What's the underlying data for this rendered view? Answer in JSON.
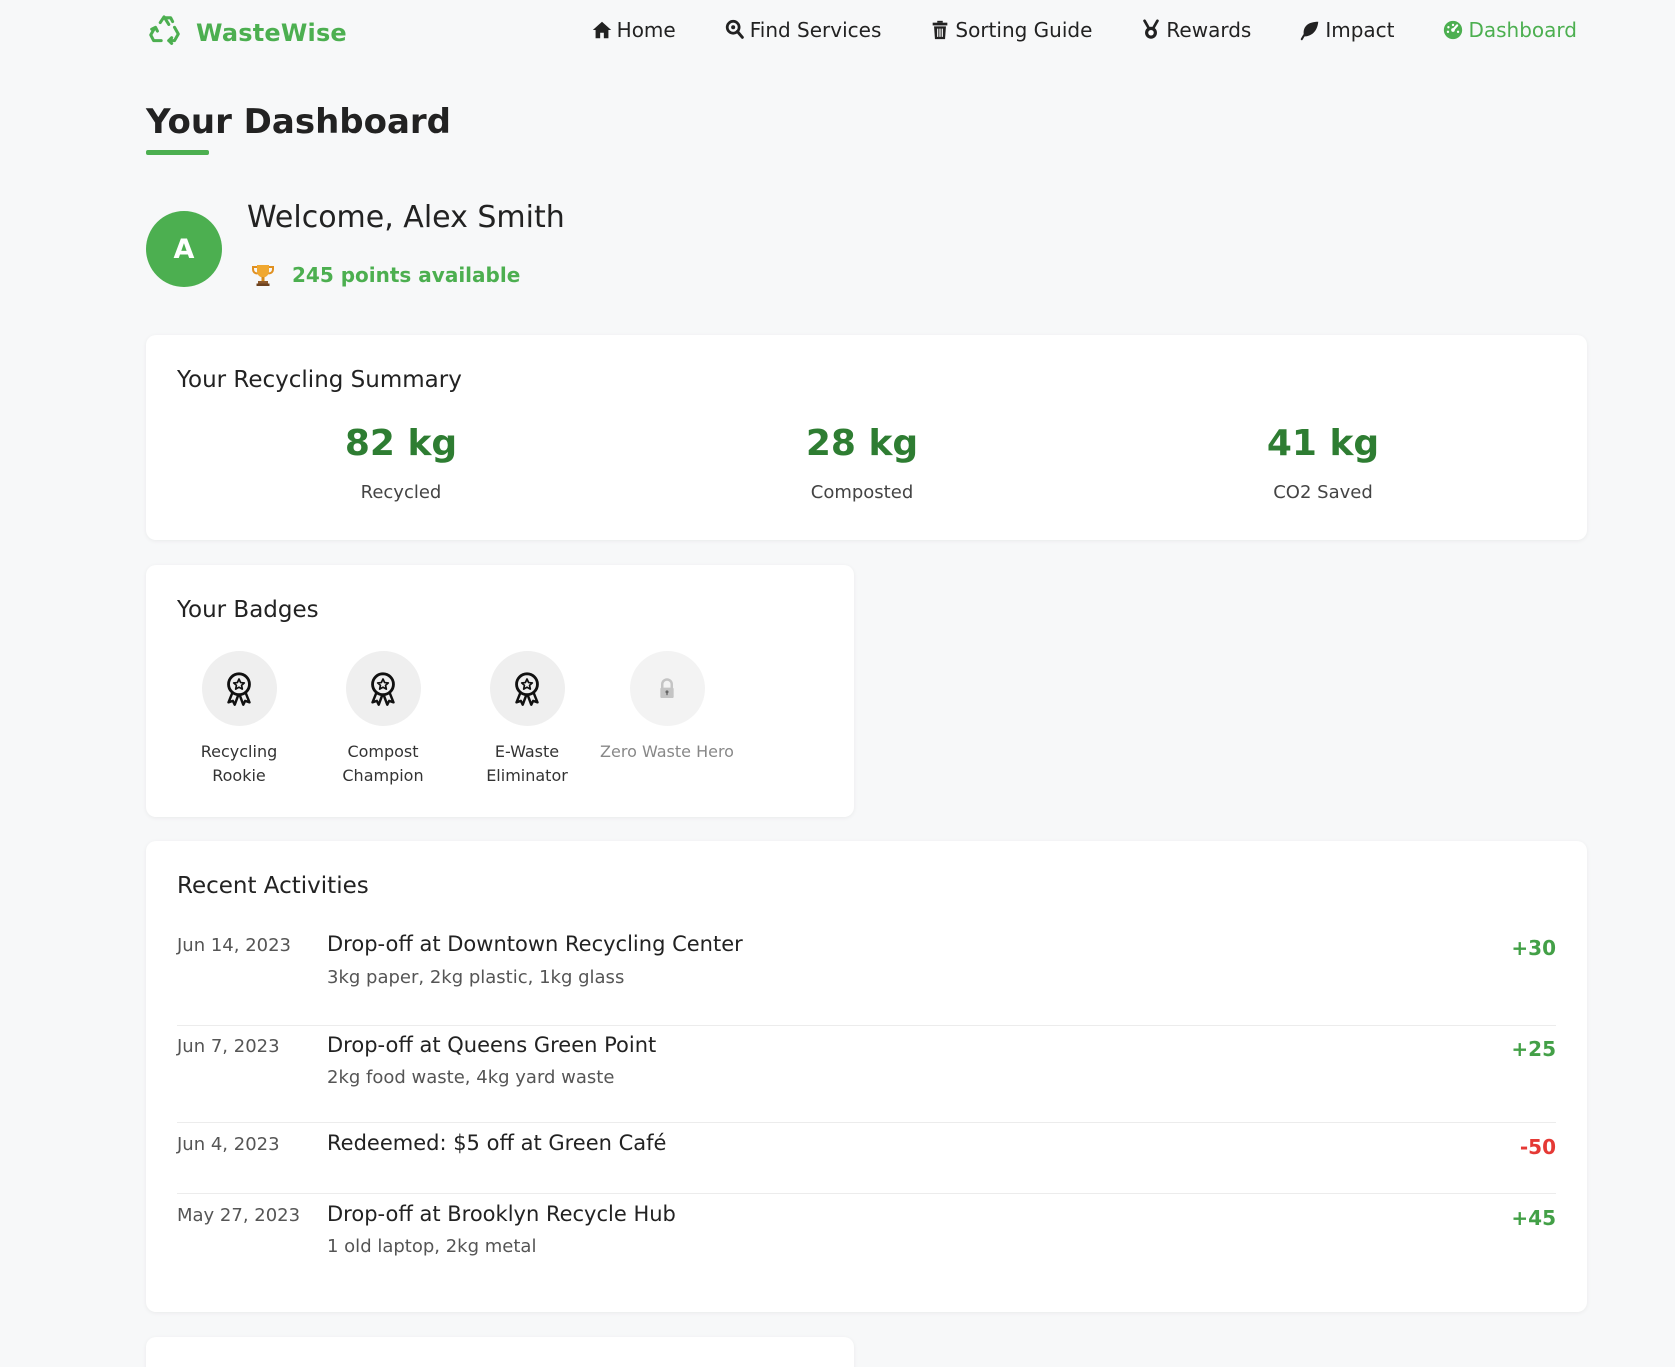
{
  "brand": {
    "name": "WasteWise",
    "color": "#4caf50",
    "icon": "recycle-icon"
  },
  "nav": {
    "items": [
      {
        "label": "Home",
        "icon": "home-icon"
      },
      {
        "label": "Find Services",
        "icon": "map-pin-icon"
      },
      {
        "label": "Sorting Guide",
        "icon": "trash-icon"
      },
      {
        "label": "Rewards",
        "icon": "medal-icon"
      },
      {
        "label": "Impact",
        "icon": "leaf-icon"
      },
      {
        "label": "Dashboard",
        "icon": "dashboard-icon",
        "active": true
      }
    ]
  },
  "page": {
    "title": "Your Dashboard"
  },
  "user": {
    "initial": "A",
    "welcome": "Welcome, Alex Smith",
    "points_text": "245 points available",
    "points_icon": "trophy-icon"
  },
  "summary": {
    "title": "Your Recycling Summary",
    "stats": [
      {
        "value": "82 kg",
        "label": "Recycled"
      },
      {
        "value": "28 kg",
        "label": "Composted"
      },
      {
        "value": "41 kg",
        "label": "CO2 Saved"
      }
    ]
  },
  "badges": {
    "title": "Your Badges",
    "items": [
      {
        "line1": "Recycling",
        "line2": "Rookie",
        "icon": "award-icon",
        "locked": false
      },
      {
        "line1": "Compost",
        "line2": "Champion",
        "icon": "award-icon",
        "locked": false
      },
      {
        "line1": "E-Waste",
        "line2": "Eliminator",
        "icon": "award-icon",
        "locked": false
      },
      {
        "line1": "Zero Waste Hero",
        "line2": "",
        "icon": "lock-icon",
        "locked": true
      }
    ]
  },
  "activities": {
    "title": "Recent Activities",
    "items": [
      {
        "date": "Jun 14, 2023",
        "title": "Drop-off at Downtown Recycling Center",
        "detail": "3kg paper, 2kg plastic, 1kg glass",
        "points": "+30"
      },
      {
        "date": "Jun 7, 2023",
        "title": "Drop-off at Queens Green Point",
        "detail": "2kg food waste, 4kg yard waste",
        "points": "+25"
      },
      {
        "date": "Jun 4, 2023",
        "title": "Redeemed: $5 off at Green Café",
        "detail": "",
        "points": "-50"
      },
      {
        "date": "May 27, 2023",
        "title": "Drop-off at Brooklyn Recycle Hub",
        "detail": "1 old laptop, 2kg metal",
        "points": "+45"
      }
    ]
  },
  "colors": {
    "accent": "#4caf50",
    "stat_value": "#2e7d32",
    "positive": "#43a047",
    "negative": "#e53935",
    "background": "#f7f8f9"
  }
}
